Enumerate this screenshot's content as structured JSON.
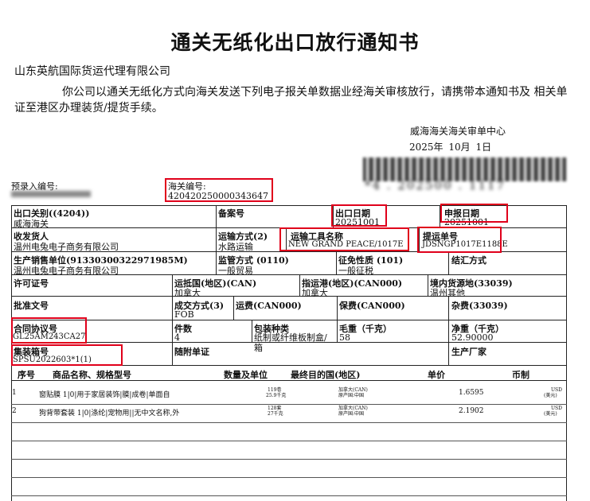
{
  "title": "通关无纸化出口放行通知书",
  "company": "山东英航国际货运代理有限公司",
  "paragraph": "你公司以通关无纸化方式向海关发送下列电子报关单数据业经海关审核放行，请携带本通知书及 相关单证至港区办理装货/提货手续。",
  "customs_center": "威海海关海关审单中心",
  "date": "2025年 10月 1日",
  "preentry": {
    "label": "预录入编号:"
  },
  "customs_no": {
    "label": "海关编号:",
    "value": "420420250000343647"
  },
  "blurred_number": "*4 . 202500 . 1117",
  "row1": {
    "exit_customs_label": "出口关别((4204))",
    "exit_customs_value": "威海海关",
    "filing_label": "备案号",
    "export_date_label": "出口日期",
    "export_date_value": "20251001",
    "declare_date_label": "申报日期",
    "declare_date_value": "20251001"
  },
  "row2": {
    "consignor_label": "收发货人",
    "consignor_value": "温州电兔电子商务有限公司",
    "transport_mode_label": "运输方式(2)",
    "transport_mode_value": "水路运输",
    "vessel_label": "运输工具名称",
    "vessel_value": "NEW GRAND PEACE/1017E",
    "bl_label": "提运单号",
    "bl_value": "JDSNGP1017E1188E"
  },
  "row3": {
    "producer_label": "生产销售单位(91330300322971985M)",
    "producer_value": "温州电兔电子商务有限公司",
    "supervision_label": "监管方式 (0110)",
    "supervision_value": "一般贸易",
    "levy_label": "征免性质 (101)",
    "levy_value": "一般征税",
    "settlement_label": "结汇方式"
  },
  "row4": {
    "license_label": "许可证号",
    "dest_country_label": "运抵国(地区)(CAN)",
    "dest_country_value": "加拿大",
    "port_label": "指运港(地区)(CAN000)",
    "port_value": "加拿大",
    "source_label": "境内货源地(33039)",
    "source_value": "温州其他"
  },
  "row5": {
    "approval_label": "批准文号",
    "deal_label": "成交方式(3)",
    "deal_value": "FOB",
    "freight_label": "运费(CAN000)",
    "insurance_label": "保费(CAN000)",
    "misc_label": "杂费(33039)"
  },
  "row6": {
    "contract_label": "合同协议号",
    "contract_value": "GL25AM243CA27",
    "pieces_label": "件数",
    "pieces_value": "4",
    "package_label": "包装种类",
    "package_value": "纸制或纤维板制盒/箱",
    "gross_label": "毛重（千克）",
    "gross_value": "58",
    "net_label": "净重（千克）",
    "net_value": "52.90000"
  },
  "row7": {
    "container_label": "集装箱号",
    "container_value": "SPSU2022603*1(1)",
    "docs_label": "随附单证",
    "manufacturer_label": "生产厂家"
  },
  "goods_header": {
    "seq": "序号",
    "name": "商品名称、规格型号",
    "qty": "数量及单位",
    "dest": "最终目的国(地区)",
    "price": "单价",
    "currency": "币制"
  },
  "goods": [
    {
      "seq": "1",
      "name": "窗贴膜 1|0|用于家居装饰|膜|成卷|单面自",
      "qty1": "119卷",
      "qty2": "25.9千克",
      "dest1": "加拿大(CAN)",
      "dest2": "原产国:中国",
      "price": "1.6595",
      "cur1": "USD",
      "cur2": "(美元)"
    },
    {
      "seq": "2",
      "name": "狗背带套装 1|0|涤纶|宠物用||无中文名称,外",
      "qty1": "128套",
      "qty2": "27千克",
      "dest1": "加拿大(CAN)",
      "dest2": "原产国:中国",
      "price": "2.1902",
      "cur1": "USD",
      "cur2": "(美元)"
    }
  ]
}
